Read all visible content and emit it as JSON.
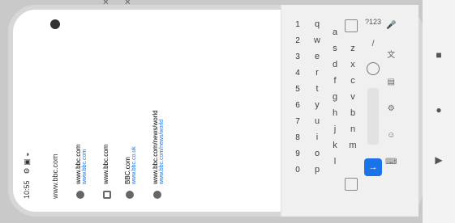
{
  "status": {
    "left": "10:55",
    "icons": [
      "wifi-icon",
      "signal-icon",
      "battery-icon",
      "settings-icon"
    ]
  },
  "address_bar": {
    "url": "www.bbc.com"
  },
  "suggestions": [
    {
      "title": "www.bbc.com",
      "url": "www.bbc.com",
      "type": "web"
    },
    {
      "title": "www.bbc.com",
      "url": "",
      "type": "search"
    },
    {
      "title": "BBC.com",
      "url": "www.bbc.co.uk",
      "type": "web"
    },
    {
      "title": "www.bbc.com/news/world",
      "url": "www.bbc.com/news/world",
      "type": "web"
    }
  ],
  "keyboard": {
    "row_numbers": [
      "1",
      "2",
      "3",
      "4",
      "5",
      "6",
      "7",
      "8",
      "9",
      "0"
    ],
    "row1": [
      "q",
      "w",
      "e",
      "r",
      "t",
      "y",
      "u",
      "i",
      "o",
      "p"
    ],
    "row2": [
      "a",
      "s",
      "d",
      "f",
      "g",
      "h",
      "j",
      "k",
      "l"
    ],
    "row3": [
      "z",
      "x",
      "c",
      "v",
      "b",
      "n",
      "m"
    ],
    "bottom_left": "?123",
    "bottom_mid": "/",
    "action": "→"
  },
  "nav": {
    "back": "▶",
    "home": "●",
    "recent": "■"
  }
}
